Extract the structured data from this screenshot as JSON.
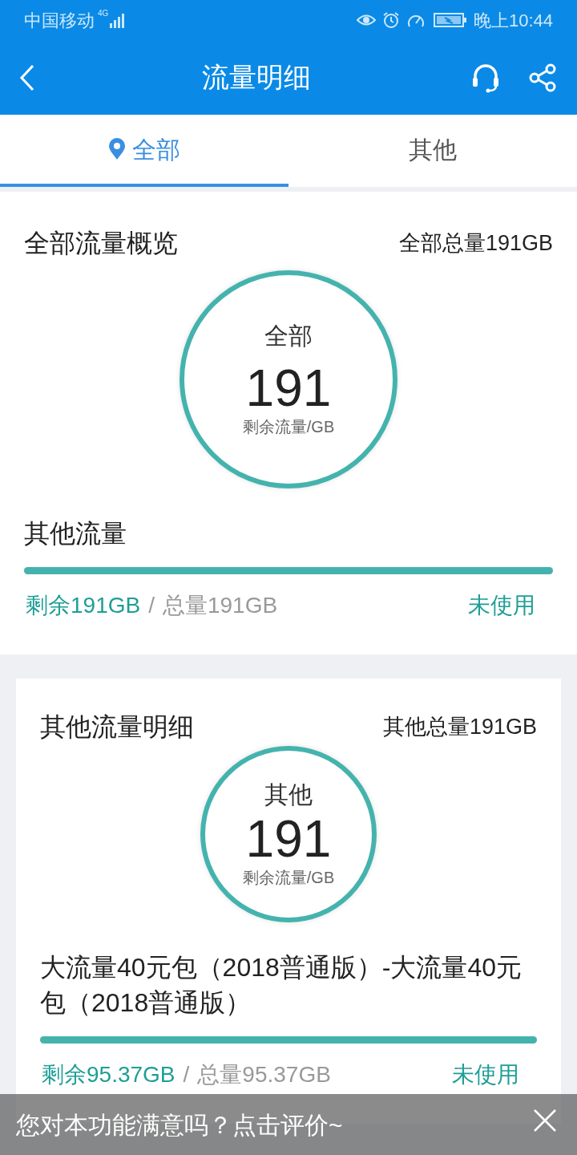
{
  "status_bar": {
    "carrier": "中国移动",
    "network": "4G",
    "time": "晚上10:44"
  },
  "header": {
    "title": "流量明细"
  },
  "tabs": [
    {
      "label": "全部",
      "selected": true
    },
    {
      "label": "其他",
      "selected": false
    }
  ],
  "sections": [
    {
      "kind": "overview",
      "title": "全部流量概览",
      "total": "全部总量191GB",
      "ring": {
        "label": "全部",
        "value": "191",
        "unit": "剩余流量/GB"
      },
      "items": [
        {
          "name": "其他流量",
          "level": 1,
          "remaining": "剩余191GB",
          "separator": "/",
          "total": "总量191GB",
          "status": "未使用"
        }
      ]
    },
    {
      "kind": "card",
      "title": "其他流量明细",
      "total": "其他总量191GB",
      "ring": {
        "label": "其他",
        "value": "191",
        "unit": "剩余流量/GB"
      },
      "items": [
        {
          "name": "大流量40元包（2018普通版）-大流量40元包（2018普通版）",
          "level": 1,
          "remaining": "剩余95.37GB",
          "separator": "/",
          "total": "总量95.37GB",
          "status": "未使用"
        }
      ]
    }
  ],
  "banner": {
    "text": "您对本功能满意吗？点击评价~"
  }
}
